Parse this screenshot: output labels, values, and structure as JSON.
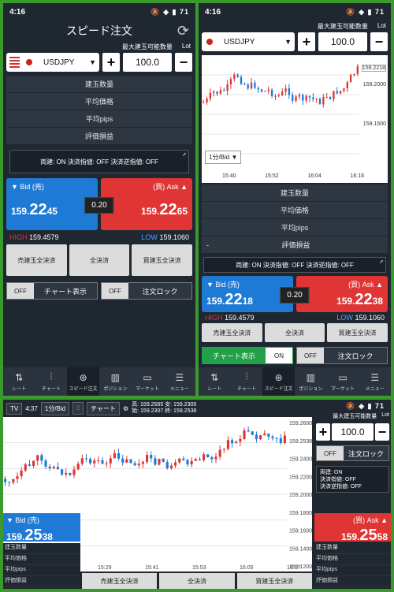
{
  "colors": {
    "bid": "#1f7ad6",
    "ask": "#e03535",
    "panel": "#1f2731",
    "frame": "#3a9a2e",
    "on": "#22a04a"
  },
  "status": {
    "time": "4:16",
    "icons": "🔕 ◈ ▮ 71"
  },
  "panel1": {
    "title": "スピード注文",
    "qty_label": "最大建玉可能数量",
    "lot": "Lot",
    "pair": "USDJPY",
    "quantity": "100.0",
    "info_rows": [
      "建玉数量",
      "平均価格",
      "平均pips",
      "評価損益"
    ],
    "notice": "両建: ON 決済指値: OFF 決済逆指値: OFF",
    "bid_label": "▼ Bid (売)",
    "bid_price_main": "159.",
    "bid_price_big": "22",
    "bid_price_small": "45",
    "ask_label": "(買) Ask ▲",
    "ask_price_main": "159.",
    "ask_price_big": "22",
    "ask_price_small": "65",
    "spread": "0.20",
    "high_label": "HIGH",
    "high": "159.4579",
    "low_label": "LOW",
    "low": "159.1060",
    "settle": [
      "売建玉全決済",
      "全決済",
      "買建玉全決済"
    ],
    "toggle1_state": "OFF",
    "toggle1_label": "チャート表示",
    "toggle2_state": "OFF",
    "toggle2_label": "注文ロック"
  },
  "panel2": {
    "qty_label": "最大建玉可能数量",
    "lot": "Lot",
    "pair": "USDJPY",
    "quantity": "100.0",
    "period": "1分/Bid",
    "price_tag": "159.2218",
    "y_ticks": [
      "159.2000",
      "159.1500"
    ],
    "time_ticks": [
      "15:40",
      "15:52",
      "16:04",
      "16:16"
    ],
    "info_rows": [
      "建玉数量",
      "平均価格",
      "平均pips",
      "評価損益"
    ],
    "dash": "-",
    "notice": "両建: ON 決済指値: OFF 決済逆指値: OFF",
    "bid_label": "▼ Bid (売)",
    "bid_price_main": "159.",
    "bid_price_big": "22",
    "bid_price_small": "18",
    "ask_label": "(買) Ask ▲",
    "ask_price_main": "159.",
    "ask_price_big": "22",
    "ask_price_small": "38",
    "spread": "0.20",
    "high_label": "HIGH",
    "high": "159.4579",
    "low_label": "LOW",
    "low": "159.1060",
    "settle": [
      "売建玉全決済",
      "全決済",
      "買建玉全決済"
    ],
    "toggle1_state": "ON",
    "toggle1_label": "チャート表示",
    "toggle2_state": "OFF",
    "toggle2_label": "注文ロック"
  },
  "nav": [
    {
      "label": "レート",
      "icon": "⇅"
    },
    {
      "label": "チャート",
      "icon": "⫶"
    },
    {
      "label": "スピード注文",
      "icon": "⊛"
    },
    {
      "label": "ポジション",
      "icon": "▥"
    },
    {
      "label": "マーケット",
      "icon": "▭"
    },
    {
      "label": "メニュー",
      "icon": "☰"
    }
  ],
  "panel3": {
    "time": "4:37",
    "period": "1分/Bid",
    "chart_btn": "チャート",
    "ohlc": "高: 159.2565 安: 159.2305\n始: 159.2307 終: 159.2538",
    "qty_label": "最大建玉可能数量",
    "lot": "Lot",
    "quantity": "100.0",
    "toggle_state": "OFF",
    "toggle_label": "注文ロック",
    "notice": "両建: ON\n決済指値: OFF\n決済逆指値: OFF",
    "bid_label": "▼ Bid (売)",
    "bid_price_main": "159.",
    "bid_price_big": "25",
    "bid_price_small": "38",
    "ask_label": "(買) Ask ▲",
    "ask_price_main": "159.",
    "ask_price_big": "25",
    "ask_price_small": "58",
    "left_rows": [
      "建玉数量",
      "平均価格",
      "平均pips",
      "評価損益"
    ],
    "right_rows": [
      "建玉数量",
      "平均価格",
      "平均pips",
      "評価損益"
    ],
    "settle": [
      "売建玉全決済",
      "全決済",
      "買建玉全決済"
    ],
    "y_ticks": [
      "159.2600",
      "159.2538",
      "159.2400",
      "159.2200",
      "159.2000",
      "159.1800",
      "159.1600",
      "159.1400",
      "159.1200"
    ],
    "time_ticks": [
      "15:29",
      "15:41",
      "15:53",
      "16:05",
      "16:17"
    ]
  }
}
